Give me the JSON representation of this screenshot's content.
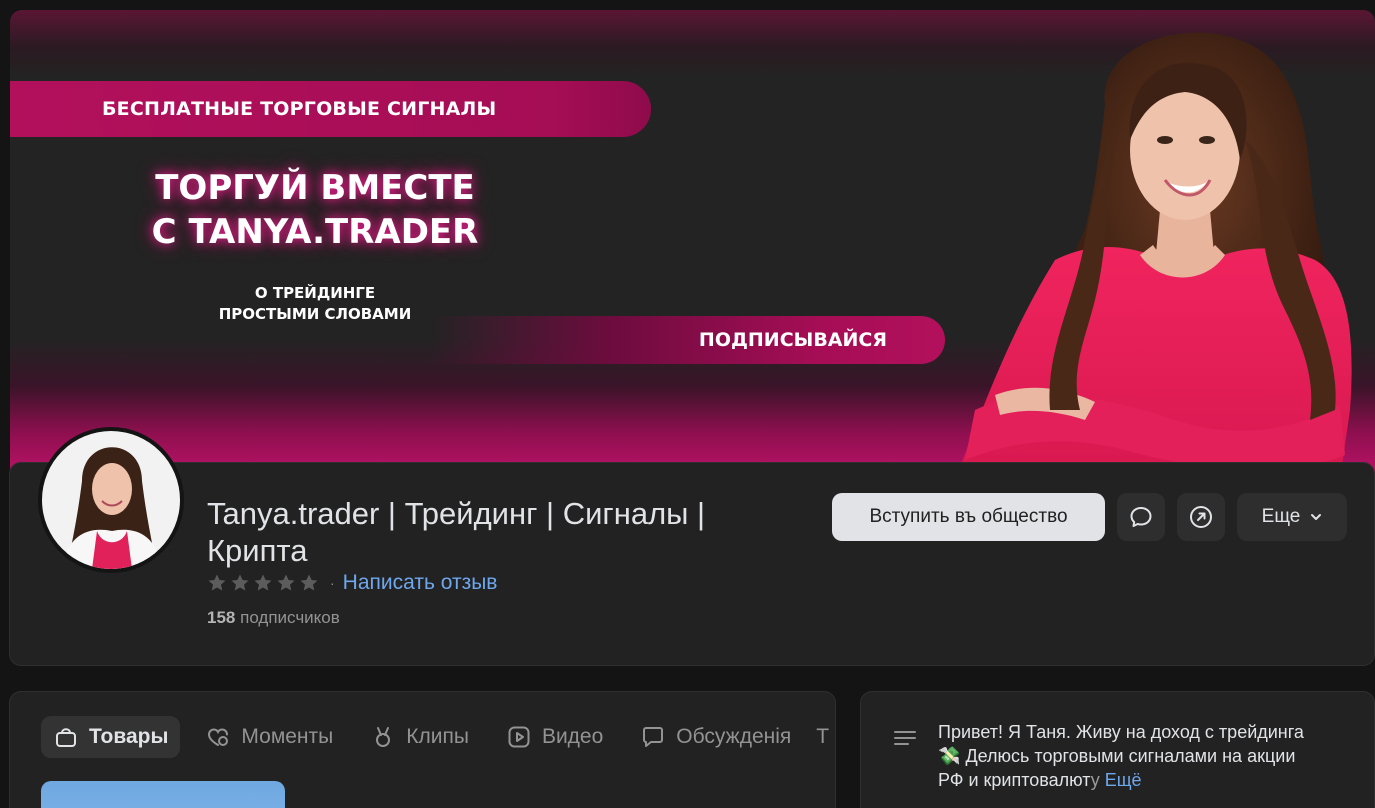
{
  "cover": {
    "top_pill": "БЕСПЛАТНЫЕ ТОРГОВЫЕ СИГНАЛЫ",
    "headline_line1": "ТОРГУЙ ВМЕСТЕ",
    "headline_line2": "С TANYA.TRADER",
    "sub_line1": "О ТРЕЙДИНГЕ",
    "sub_line2": "ПРОСТЫМИ СЛОВАМИ",
    "cta_pill": "ПОДПИСЫВАЙСЯ",
    "accent": "#b3105c"
  },
  "profile": {
    "title": "Tanya.trader | Трейдинг | Сигналы | Крипта",
    "rating_stars": 5,
    "rating_filled": 0,
    "review_link": "Написать отзыв",
    "subscribers_count": "158",
    "subscribers_label": "подписчиков"
  },
  "actions": {
    "join": "Вступить въ общество",
    "message_icon": "chat-bubble-icon",
    "share_icon": "share-arrow-icon",
    "more": "Еще"
  },
  "tabs": [
    {
      "label": "Товары",
      "icon": "shopping-bag-icon",
      "active": true
    },
    {
      "label": "Моменты",
      "icon": "heart-moments-icon",
      "active": false
    },
    {
      "label": "Клипы",
      "icon": "clips-icon",
      "active": false
    },
    {
      "label": "Видео",
      "icon": "video-icon",
      "active": false
    },
    {
      "label": "Обсужденія",
      "icon": "discussion-icon",
      "active": false
    }
  ],
  "tabs_overflow": "Т",
  "about": {
    "line1": "Привет! Я Таня. Живу на доход с трейдинга",
    "emoji": "💸",
    "line2": "Делюсь торговыми сигналами на акции",
    "line3_visible": "РФ и криптовалют",
    "line3_fade": "у",
    "more": "Ещё"
  },
  "colors": {
    "background": "#141414",
    "card": "#222222",
    "link": "#6ea7ec",
    "button_light": "#e1e3e6",
    "button_dark": "#2e2e2e"
  }
}
